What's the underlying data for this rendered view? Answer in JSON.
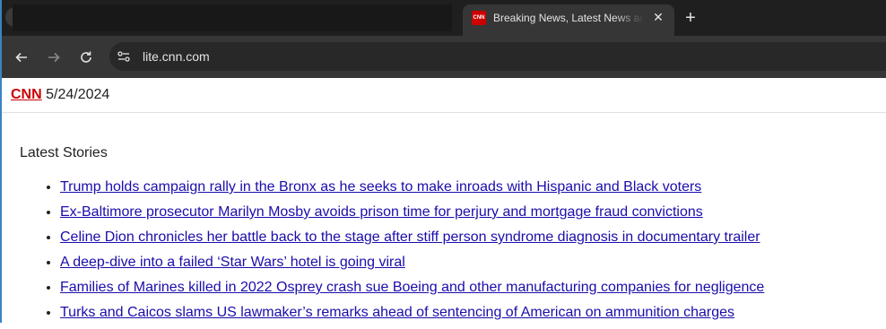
{
  "browser": {
    "tab_title": "Breaking News, Latest News and Videos | CNN",
    "favicon_text": "CNN",
    "url": "lite.cnn.com",
    "icons": [
      "back-icon",
      "forward-icon",
      "reload-icon",
      "site-info-icon",
      "close-icon",
      "plus-icon"
    ]
  },
  "header": {
    "brand": "CNN",
    "date": "5/24/2024"
  },
  "main": {
    "section_title": "Latest Stories",
    "stories": [
      "Trump holds campaign rally in the Bronx as he seeks to make inroads with Hispanic and Black voters",
      "Ex-Baltimore prosecutor Marilyn Mosby avoids prison time for perjury and mortgage fraud convictions",
      "Celine Dion chronicles her battle back to the stage after stiff person syndrome diagnosis in documentary trailer",
      "A deep-dive into a failed ‘Star Wars’ hotel is going viral",
      "Families of Marines killed in 2022 Osprey crash sue Boeing and other manufacturing companies for negligence",
      "Turks and Caicos slams US lawmaker’s remarks ahead of sentencing of American on ammunition charges"
    ]
  },
  "colors": {
    "tabstrip": "#1f1f1f",
    "toolbar": "#363636",
    "brand_red": "#cc0000",
    "link": "#1a0dab"
  }
}
